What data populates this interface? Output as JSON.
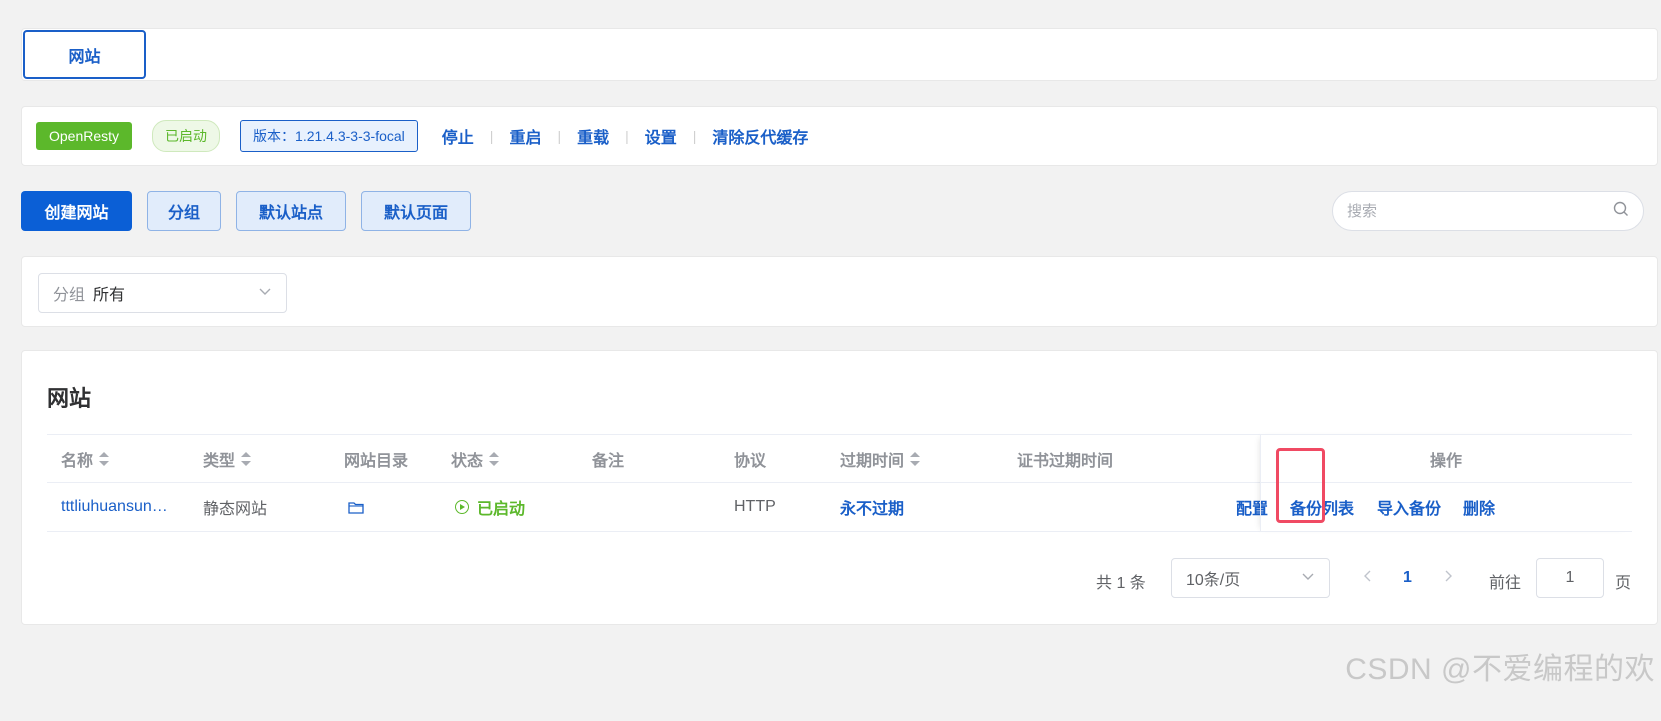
{
  "tabs": {
    "active_tab": "网站"
  },
  "app_bar": {
    "app_name": "OpenResty",
    "status": "已启动",
    "version": "版本：1.21.4.3-3-3-focal",
    "actions": [
      "停止",
      "重启",
      "重载",
      "设置",
      "清除反代缓存"
    ]
  },
  "toolbar": {
    "create": "创建网站",
    "group": "分组",
    "default_site": "默认站点",
    "default_page": "默认页面",
    "search_placeholder": "搜索"
  },
  "filter": {
    "label": "分组",
    "value": "所有"
  },
  "table": {
    "title": "网站",
    "columns": {
      "name": "名称",
      "type": "类型",
      "dir": "网站目录",
      "status": "状态",
      "remark": "备注",
      "protocol": "协议",
      "expire": "过期时间",
      "cert_expire": "证书过期时间",
      "ops": "操作"
    },
    "rows": [
      {
        "name": "tttliuhuansun…",
        "type": "静态网站",
        "status": "已启动",
        "remark": "",
        "protocol": "HTTP",
        "expire": "永不过期",
        "cert_expire": "",
        "ops": [
          "配置",
          "备份列表",
          "导入备份",
          "删除"
        ]
      }
    ]
  },
  "pagination": {
    "total": "共 1 条",
    "page_size": "10条/页",
    "current_page": "1",
    "goto_label": "前往",
    "goto_value": "1",
    "page_suffix": "页"
  },
  "watermark": "CSDN @不爱编程的欢",
  "colors": {
    "primary": "#0b5fd6",
    "success": "#5cb82b",
    "highlight": "#f04a63"
  }
}
